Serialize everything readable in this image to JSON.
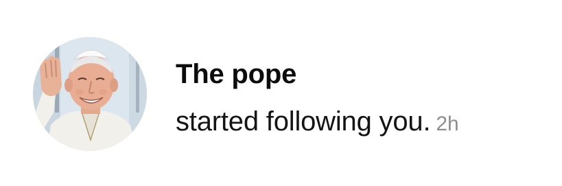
{
  "notification": {
    "username": "The pope",
    "message": "started following you.",
    "timestamp": "2h",
    "avatar_icon": "user-avatar-photo"
  }
}
